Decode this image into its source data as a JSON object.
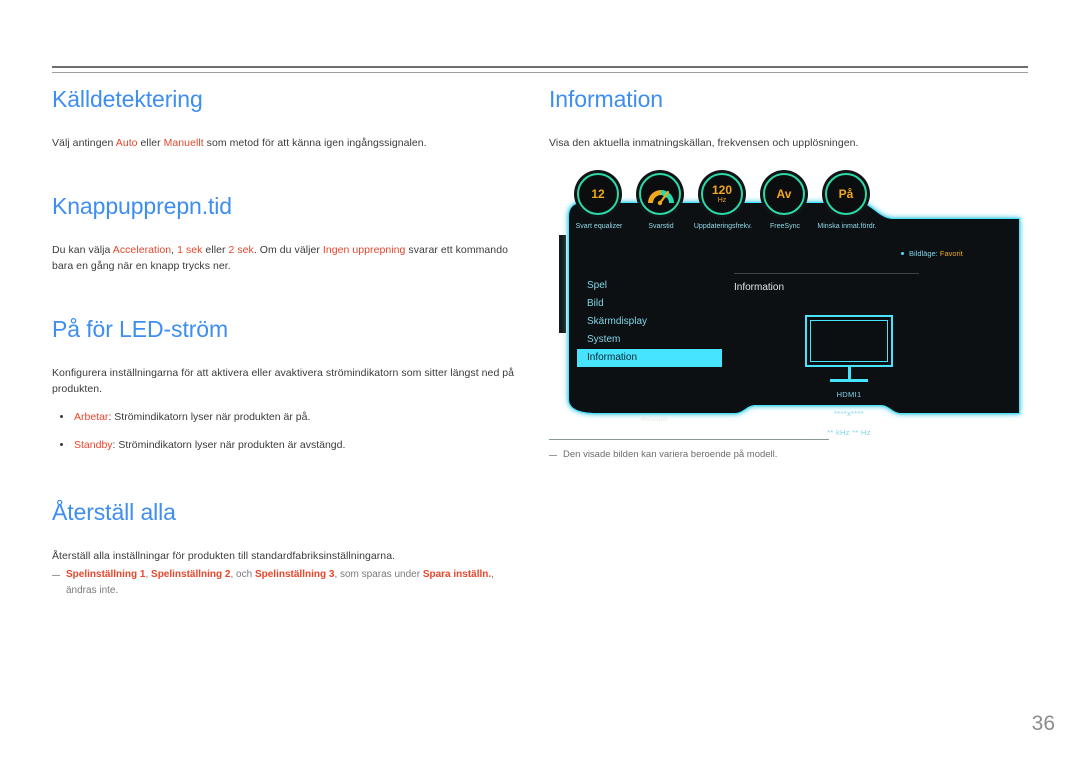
{
  "page": {
    "number": "36"
  },
  "left_column": {
    "sections": [
      {
        "heading": "Källdetektering",
        "body_runs": [
          {
            "t": "Välj antingen ",
            "c": "n"
          },
          {
            "t": "Auto",
            "c": "r"
          },
          {
            "t": " eller ",
            "c": "n"
          },
          {
            "t": "Manuellt",
            "c": "r"
          },
          {
            "t": " som metod för att känna igen ingångssignalen.",
            "c": "n"
          }
        ]
      },
      {
        "heading": "Knappupprepn.tid",
        "body_runs": [
          {
            "t": "Du kan välja ",
            "c": "n"
          },
          {
            "t": "Acceleration",
            "c": "r"
          },
          {
            "t": ", ",
            "c": "n"
          },
          {
            "t": "1 sek",
            "c": "r"
          },
          {
            "t": " eller ",
            "c": "n"
          },
          {
            "t": "2 sek",
            "c": "r"
          },
          {
            "t": ". Om du väljer ",
            "c": "n"
          },
          {
            "t": "Ingen upprepning",
            "c": "r"
          },
          {
            "t": " svarar ett kommando bara en gång när en knapp trycks ner.",
            "c": "n"
          }
        ]
      },
      {
        "heading": "På för LED-ström",
        "body_runs": [
          {
            "t": "Konfigurera inställningarna för att aktivera eller avaktivera strömindikatorn som sitter längst ned på produkten.",
            "c": "n"
          }
        ],
        "bullets": [
          [
            {
              "t": "Arbetar",
              "c": "r"
            },
            {
              "t": ": Strömindikatorn lyser när produkten är på.",
              "c": "n"
            }
          ],
          [
            {
              "t": "Standby",
              "c": "r"
            },
            {
              "t": ": Strömindikatorn lyser när produkten är avstängd.",
              "c": "n"
            }
          ]
        ]
      },
      {
        "heading": "Återställ alla",
        "body_runs": [
          {
            "t": "Återställ alla inställningar för produkten till standardfabriksinställningarna.",
            "c": "n"
          }
        ],
        "note_runs": [
          {
            "t": "Spelinställning 1",
            "c": "rb"
          },
          {
            "t": ", ",
            "c": "g"
          },
          {
            "t": "Spelinställning 2",
            "c": "rb"
          },
          {
            "t": ", och ",
            "c": "g"
          },
          {
            "t": "Spelinställning 3",
            "c": "rb"
          },
          {
            "t": ", som sparas under ",
            "c": "g"
          },
          {
            "t": "Spara inställn.",
            "c": "rb"
          },
          {
            "t": ", ändras inte.",
            "c": "g"
          }
        ]
      }
    ]
  },
  "right_column": {
    "heading": "Information",
    "body": "Visa den aktuella inmatningskällan, frekvensen och upplösningen.",
    "note": "Den visade bilden kan variera beroende på modell.",
    "osd": {
      "gauges": [
        {
          "value": "12",
          "unit": "",
          "label": "Svart equalizer",
          "icon": "number-gauge"
        },
        {
          "value": "",
          "unit": "",
          "label": "Svarstid",
          "icon": "dial-gauge"
        },
        {
          "value": "120",
          "unit": "Hz",
          "label": "Uppdateringsfrekv.",
          "icon": "number-gauge"
        },
        {
          "value": "Av",
          "unit": "",
          "label": "FreeSync",
          "icon": "text-gauge"
        },
        {
          "value": "På",
          "unit": "",
          "label": "Minska inmat.fördr.",
          "icon": "text-gauge"
        }
      ],
      "mode_badge": {
        "key": "Bildläge:",
        "value": "Favorit"
      },
      "menu_items": [
        {
          "label": "Spel",
          "selected": false
        },
        {
          "label": "Bild",
          "selected": false
        },
        {
          "label": "Skärmdisplay",
          "selected": false
        },
        {
          "label": "System",
          "selected": false
        },
        {
          "label": "Information",
          "selected": true
        }
      ],
      "exit_label": "Avsluta",
      "detail_title": "Information",
      "monitor": {
        "source": "HDMI1",
        "resolution": "****x****",
        "frequency": "** kHz ** Hz"
      }
    }
  },
  "colors": {
    "heading_blue": "#3d8ef0",
    "accent_red": "#e8462c",
    "osd_cyan": "#47e4ff",
    "osd_green": "#2bd9a8",
    "osd_amber": "#f0a81e",
    "osd_bg": "#0d1012"
  }
}
